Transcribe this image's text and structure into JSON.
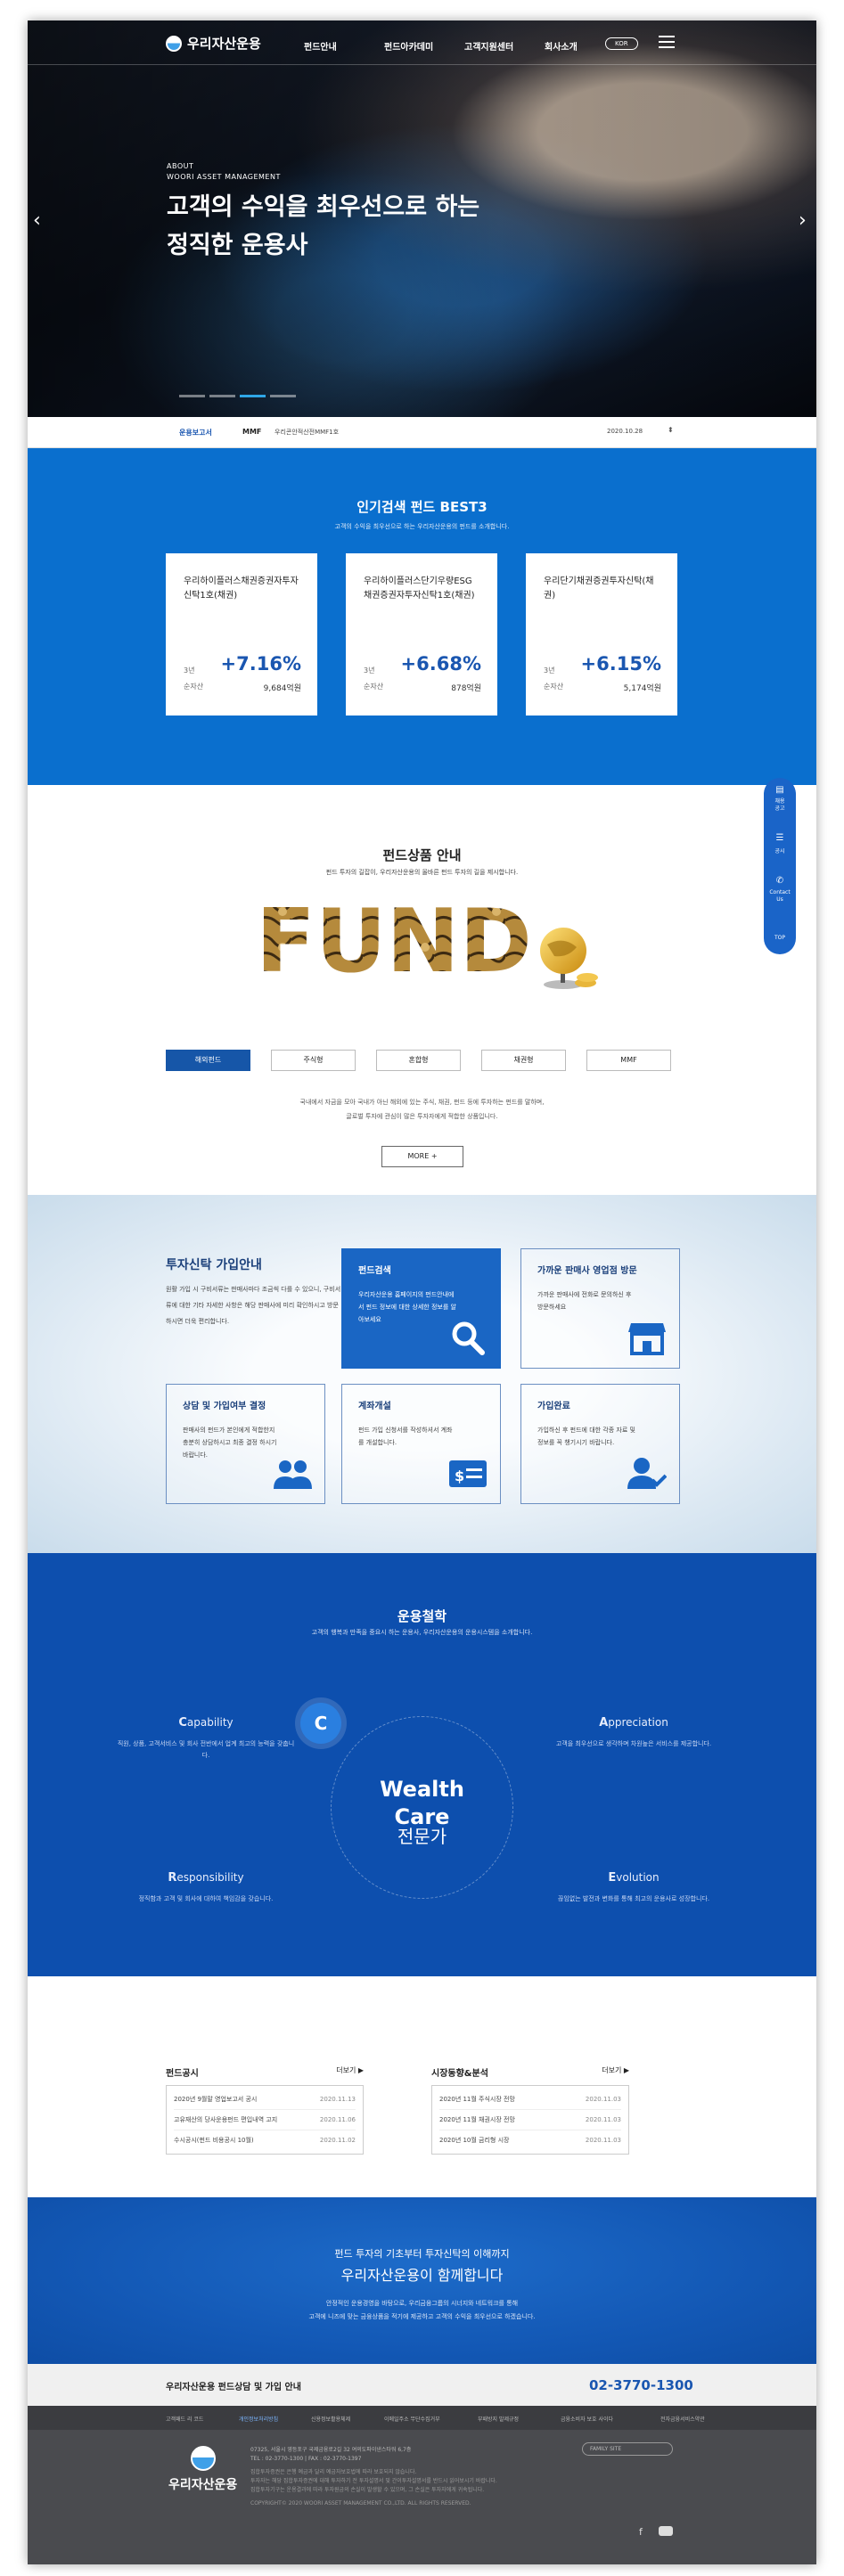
{
  "header": {
    "logo_text": "우리자산운용",
    "nav": [
      "펀드안내",
      "펀드아카데미",
      "고객지원센터",
      "회사소개"
    ],
    "lang_label": "KOR"
  },
  "hero": {
    "about": "ABOUT",
    "about_sub": "WOORI ASSET MANAGEMENT",
    "title_line1": "고객의 수익을 최우선으로 하는",
    "title_line2": "정직한 운용사",
    "prev_icon": "‹",
    "next_icon": "›",
    "slide_count": 4,
    "active_slide": 3
  },
  "ticker": {
    "label": "운용보고서",
    "category": "MMF",
    "fund_name": "우리콘안적산전MMF1호",
    "date": "2020.10.28"
  },
  "best3": {
    "title": "인기검색 펀드 BEST3",
    "subtitle": "고객의 수익을 최우선으로 하는 우리자산운용의 펀드를 소개합니다.",
    "cards": [
      {
        "name": "우리하이플러스채권증권자투자신탁1호(채권)",
        "period": "3년",
        "rate": "+7.16%",
        "net_label": "순자산",
        "amount": "9,684억원"
      },
      {
        "name": "우리하이플러스단기우량ESG채권증권자투자신탁1호(채권)",
        "period": "3년",
        "rate": "+6.68%",
        "net_label": "순자산",
        "amount": "878억원"
      },
      {
        "name": "우리단기채권증권투자신탁(채권)",
        "period": "3년",
        "rate": "+6.15%",
        "net_label": "순자산",
        "amount": "5,174억원"
      }
    ]
  },
  "products": {
    "title": "펀드상품 안내",
    "subtitle": "펀드 투자의 길잡이, 우리자산운용의 올바른 펀드 투자의 길을 제시합니다.",
    "image_word": "FUND",
    "tabs": [
      "해외펀드",
      "주식형",
      "혼합형",
      "채권형",
      "MMF"
    ],
    "active_tab": 0,
    "desc_line1": "국내에서 자금을 모아 국내가 아닌 해외에 있는 주식, 채권, 펀드 등에 투자하는 펀드를 말하며,",
    "desc_line2": "글로벌 투자에 관심이 많은 투자자에게 적합한 상품입니다.",
    "more_label": "MORE +"
  },
  "quick": {
    "items": [
      {
        "icon": "document-icon",
        "label": "채용\n공고"
      },
      {
        "icon": "list-icon",
        "label": "공시"
      },
      {
        "icon": "phone-icon",
        "label": "Contact\nUs"
      }
    ],
    "top_label": "TOP"
  },
  "join": {
    "title": "투자신탁 가입안내",
    "desc": "원활 가입 시 구비서류는 판매사마다 조금씩 다를 수 있으니, 구비서류에 대한 기타 자세한 사항은 해당 판매사에 미리 확인하시고 방문하시면 더욱 편리합니다.",
    "boxes": [
      {
        "title": "펀드검색",
        "desc": "우리자산운용 홈페이지의 펀드안내에서 펀드 정보에 대한 상세한 정보를 알아보세요",
        "icon": "search-icon"
      },
      {
        "title": "가까운 판매사 영업점 방문",
        "desc": "가까운 판매사에 전화로 문의하신 후 방문하세요",
        "icon": "store-icon"
      },
      {
        "title": "상담 및 가입여부 결정",
        "desc": "판매사의 펀드가 본인에게 적합한지 충분히 상담하시고 최종 결정 하시기 바랍니다.",
        "icon": "users-icon"
      },
      {
        "title": "계좌개설",
        "desc": "펀드 가입 신청서를 작성하셔서 계좌를 개설합니다.",
        "icon": "card-icon"
      },
      {
        "title": "가입완료",
        "desc": "가입하신 후 펀드에 대한 각종 자료 및 정보를 꼭 챙기시기 바랍니다.",
        "icon": "user-check-icon"
      }
    ]
  },
  "philosophy": {
    "title": "운용철학",
    "subtitle": "고객의 행복과 만족을 중요시 하는 운용사, 우리자산운용의 운용시스템을 소개합니다.",
    "center_badge": "C",
    "center_title1": "Wealth",
    "center_title2": "Care",
    "center_title3": "전문가",
    "points": [
      {
        "initial": "C",
        "rest": "apability",
        "desc": "직원, 상품, 고객서비스 및 회사 전반에서 업계 최고의 능력을 갖춥니다."
      },
      {
        "initial": "A",
        "rest": "ppreciation",
        "desc": "고객을 최우선으로 생각하며 차원높은 서비스를 제공합니다."
      },
      {
        "initial": "R",
        "rest": "esponsibility",
        "desc": "정직함과 고객 및 회사에 대하여 책임감을 갖습니다."
      },
      {
        "initial": "E",
        "rest": "volution",
        "desc": "끊임없는 발전과 변화를 통해 최고의 운용사로 성장합니다."
      }
    ]
  },
  "news": {
    "left_title": "펀드공시",
    "right_title": "시장동향&분석",
    "more_label": "더보기 ▶",
    "left_items": [
      {
        "text": "2020년 9월말 영업보고서 공시",
        "date": "2020.11.13"
      },
      {
        "text": "고유재산의 당사운용펀드 편입내역 고지",
        "date": "2020.11.06"
      },
      {
        "text": "수시공시(펀드 비용공시 10월)",
        "date": "2020.11.02"
      }
    ],
    "right_items": [
      {
        "text": "2020년 11월 주식시장 전망",
        "date": "2020.11.03"
      },
      {
        "text": "2020년 11월 채권시장 전망",
        "date": "2020.11.03"
      },
      {
        "text": "2020년 10월 금리형 시장",
        "date": "2020.11.03"
      }
    ]
  },
  "banner": {
    "line1": "펀드 투자의 기초부터 투자신탁의 이해까지",
    "line2": "우리자산운용이 함께합니다",
    "line3": "안정적인 운용경영을 바탕으로, 우리금융그룹의 시너지와 네트워크를 통해",
    "line4": "고객에 니즈에 맞는 금융상품을 적기에 제공하고 고객의 수익을 최우선으로 하겠습니다."
  },
  "callcenter": {
    "label": "우리자산운용 펀드상담 및 가입 안내",
    "phone": "02-3770-1300"
  },
  "footer": {
    "links": [
      "고객패드 리 코드",
      "개인정보처리방침",
      "신용정보활용체제",
      "이메일주소 무단수집거부",
      "부패방지 발제규정",
      "금융소비자 보호 사이다",
      "전자금융서비스약관"
    ],
    "logo_text": "우리자산운용",
    "address": "07325, 서울시 영등포구 국제금융로2길 32 여의도파이낸스타워 6,7층",
    "tel": "TEL : 02-3770-1300  |  FAX : 02-3770-1397",
    "notice1": "집합투자증권은 은행 예금과 달리 예금자보호법에 따라 보호되지 않습니다.",
    "notice2": "투자자는 해당 집합투자증권에 대해 투자하기 전 투자설명서 및 간이투자설명서를 반드시 읽어보시기 바랍니다.",
    "notice3": "집합투자기구는 운용결과에 따라 투자원금의 손실이 발생할 수 있으며, 그 손실은 투자자에게 귀속됩니다.",
    "copyright": "COPYRIGHT© 2020 WOORI ASSET MANAGEMENT CO.,LTD. ALL RIGHTS RESERVED.",
    "family_site": "FAMILY SITE"
  }
}
